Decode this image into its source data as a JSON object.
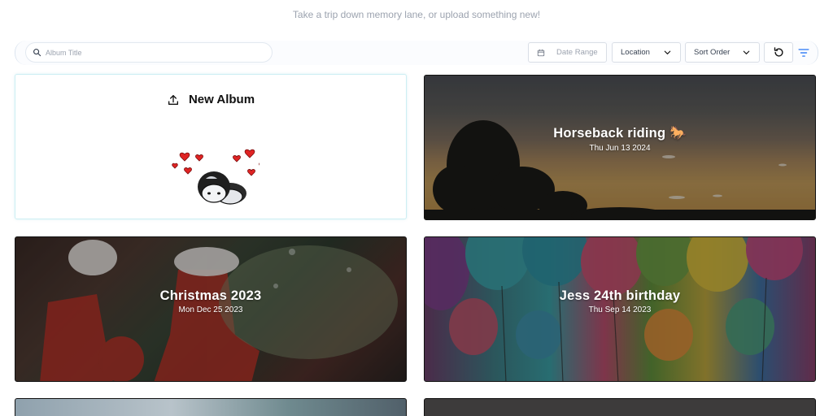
{
  "header": {
    "subtitle": "Take a trip down memory lane, or upload something new!"
  },
  "toolbar": {
    "search_placeholder": "Album Title",
    "date_range_label": "Date Range",
    "location_label": "Location",
    "sort_order_label": "Sort Order"
  },
  "new_album": {
    "label": "New Album"
  },
  "albums": [
    {
      "title": "Horseback riding 🐎",
      "date": "Thu Jun 13 2024"
    },
    {
      "title": "Christmas 2023",
      "date": "Mon Dec 25 2023"
    },
    {
      "title": "Jess 24th birthday",
      "date": "Thu Sep 14 2023"
    }
  ],
  "colors": {
    "accent": "#3b82f6",
    "card_border": "#cdeef3"
  }
}
